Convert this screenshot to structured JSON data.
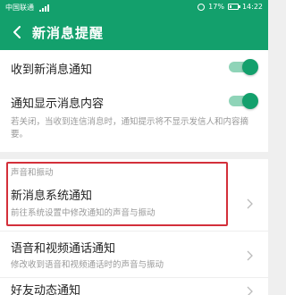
{
  "status_bar": {
    "carrier": "中国联通",
    "battery_percent": "17%",
    "battery_level": 0.17,
    "time": "14:22"
  },
  "header": {
    "title": "新消息提醒",
    "back_icon": "back-arrow-icon"
  },
  "settings": {
    "receive_notifications": {
      "label": "收到新消息通知",
      "enabled": true
    },
    "show_content": {
      "label": "通知显示消息内容",
      "enabled": true,
      "hint": "若关闭，当收到连信消息时，通知提示将不显示发信人和内容摘要。"
    }
  },
  "sound_section": {
    "header": "声音和振动",
    "system_notification": {
      "label": "新消息系统通知",
      "subtitle": "前往系统设置中修改通知的声音与振动"
    },
    "voice_video": {
      "label": "语音和视频通话通知",
      "subtitle": "修改收到语音和视频通话时的声音与振动"
    },
    "friend_updates": {
      "label": "好友动态通知"
    }
  },
  "colors": {
    "accent": "#13a06c",
    "highlight": "#d32f3a"
  }
}
